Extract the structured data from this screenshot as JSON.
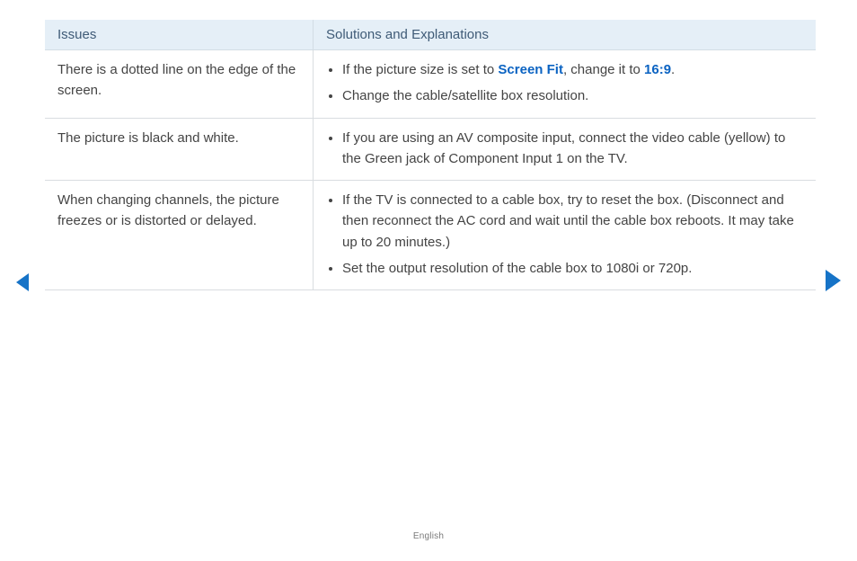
{
  "table": {
    "headers": {
      "issues": "Issues",
      "solutions": "Solutions and Explanations"
    },
    "rows": [
      {
        "issue": "There is a dotted line on the edge of the screen.",
        "solutions": [
          {
            "pre": "If the picture size is set to ",
            "hl1": "Screen Fit",
            "mid": ", change it to ",
            "hl2": "16:9",
            "post": "."
          },
          {
            "text": "Change the cable/satellite box resolution."
          }
        ]
      },
      {
        "issue": "The picture is black and white.",
        "solutions": [
          {
            "text": "If you are using an AV composite input, connect the video cable (yellow) to the Green jack of Component Input 1 on the TV."
          }
        ]
      },
      {
        "issue": "When changing channels, the picture freezes or is distorted or delayed.",
        "solutions": [
          {
            "text": "If the TV is connected to a cable box, try to reset the box. (Disconnect and then reconnect the AC cord and wait until the cable box reboots. It may take up to 20 minutes.)"
          },
          {
            "text": "Set the output resolution of the cable box to 1080i or 720p."
          }
        ]
      }
    ]
  },
  "footer": {
    "language": "English"
  }
}
